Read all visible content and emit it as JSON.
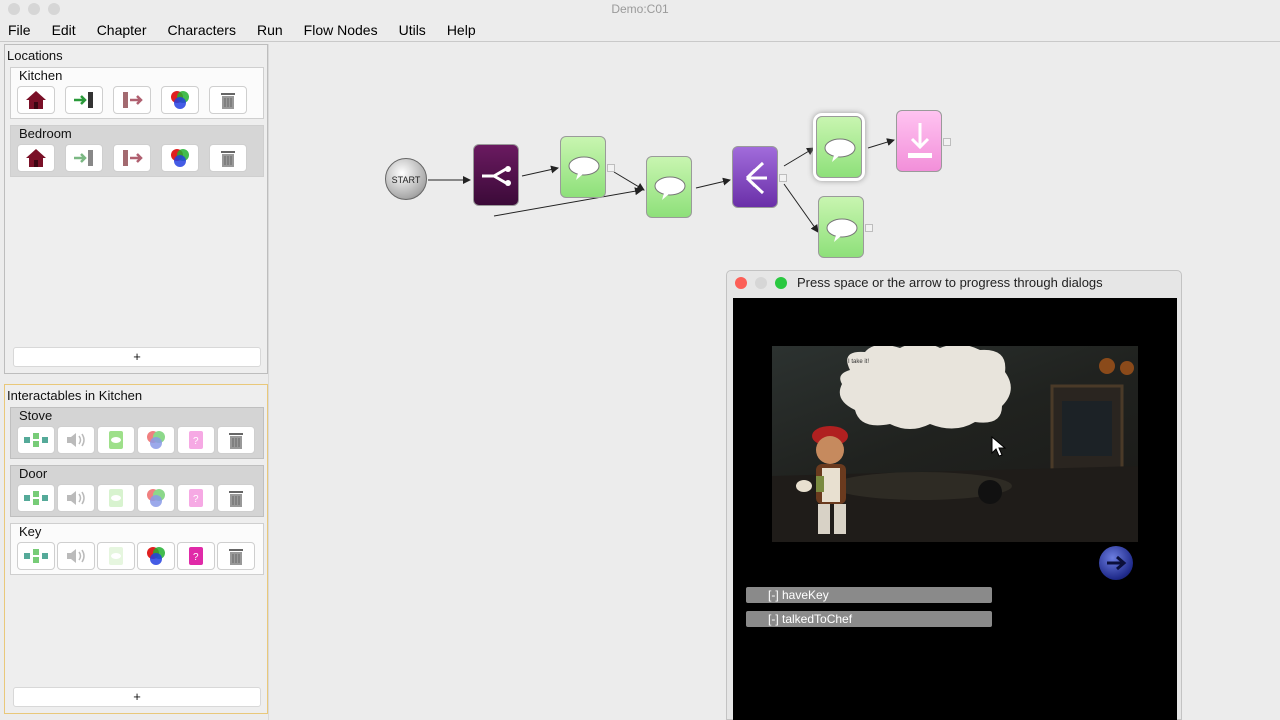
{
  "window": {
    "title": "Demo:C01"
  },
  "menu": [
    "File",
    "Edit",
    "Chapter",
    "Characters",
    "Run",
    "Flow Nodes",
    "Utils",
    "Help"
  ],
  "locations": {
    "title": "Locations",
    "items": [
      {
        "label": "Kitchen"
      },
      {
        "label": "Bedroom"
      }
    ],
    "add_label": "+"
  },
  "interactables": {
    "title": "Interactables in Kitchen",
    "items": [
      {
        "label": "Stove"
      },
      {
        "label": "Door"
      },
      {
        "label": "Key"
      }
    ],
    "add_label": "+"
  },
  "flow": {
    "start_label": "START"
  },
  "dialog": {
    "title": "Press space or the arrow to progress through dialogs",
    "speech": "I take it!",
    "flags": [
      "[-]  haveKey",
      "[-]  talkedToChef"
    ]
  },
  "colors": {
    "node_green": "#a6ea8c",
    "node_purple": "#8a4cc6",
    "node_dark": "#4e0f48",
    "node_pink": "#f7a9e6",
    "panel_highlight": "#e9c87a"
  }
}
